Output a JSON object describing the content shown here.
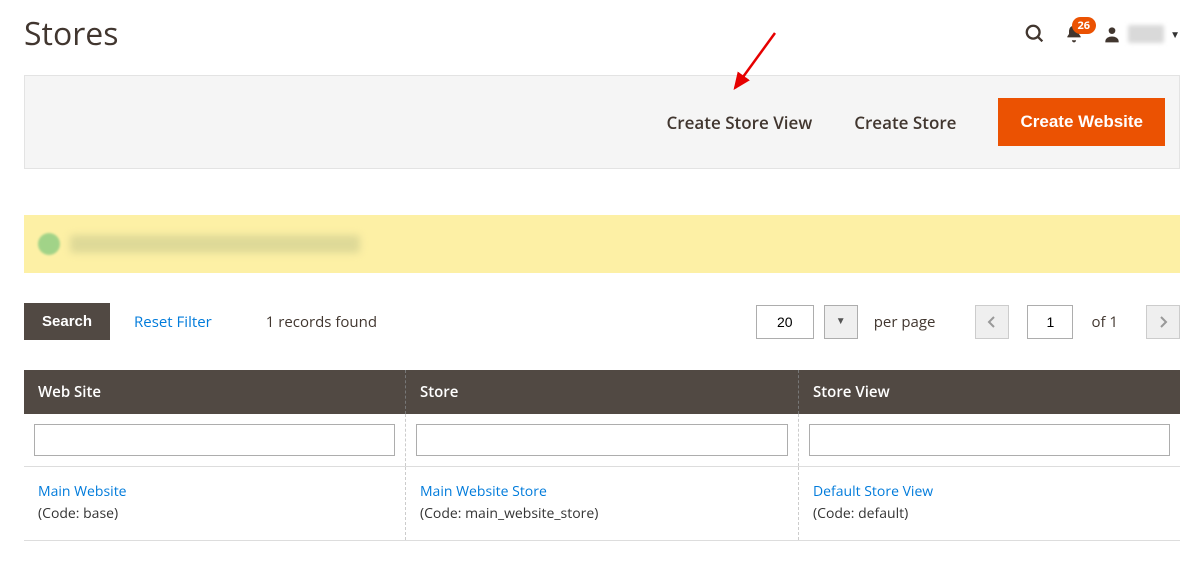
{
  "header": {
    "title": "Stores",
    "notification_count": "26"
  },
  "actions": {
    "create_store_view": "Create Store View",
    "create_store": "Create Store",
    "create_website": "Create Website"
  },
  "toolbar": {
    "search_label": "Search",
    "reset_filter": "Reset Filter",
    "records_found": "1 records found",
    "per_page_value": "20",
    "per_page_label": "per page",
    "page_value": "1",
    "page_of": "of 1"
  },
  "table": {
    "headers": {
      "website": "Web Site",
      "store": "Store",
      "store_view": "Store View"
    },
    "row": {
      "website_name": "Main Website",
      "website_code": "(Code: base)",
      "store_name": "Main Website Store",
      "store_code": "(Code: main_website_store)",
      "store_view_name": "Default Store View",
      "store_view_code": "(Code: default)"
    }
  }
}
